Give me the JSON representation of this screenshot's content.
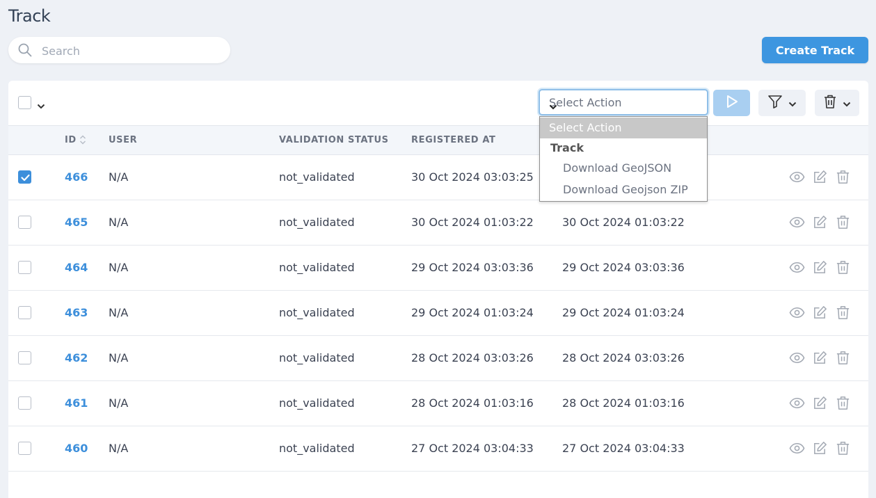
{
  "page": {
    "title": "Track"
  },
  "search": {
    "placeholder": "Search"
  },
  "create_button": {
    "label": "Create Track"
  },
  "toolbar": {
    "select_action": {
      "value": "Select Action"
    }
  },
  "dropdown": {
    "selected": "Select Action",
    "group_label": "Track",
    "options": [
      "Download GeoJSON",
      "Download Geojson ZIP"
    ]
  },
  "table": {
    "headers": {
      "id": "ID",
      "user": "USER",
      "validation_status": "VALIDATION STATUS",
      "registered_at": "REGISTERED AT"
    },
    "rows": [
      {
        "checked": true,
        "id": "466",
        "user": "N/A",
        "status": "not_validated",
        "registered": "30 Oct 2024 03:03:25",
        "updated": ""
      },
      {
        "checked": false,
        "id": "465",
        "user": "N/A",
        "status": "not_validated",
        "registered": "30 Oct 2024 01:03:22",
        "updated": "30 Oct 2024 01:03:22"
      },
      {
        "checked": false,
        "id": "464",
        "user": "N/A",
        "status": "not_validated",
        "registered": "29 Oct 2024 03:03:36",
        "updated": "29 Oct 2024 03:03:36"
      },
      {
        "checked": false,
        "id": "463",
        "user": "N/A",
        "status": "not_validated",
        "registered": "29 Oct 2024 01:03:24",
        "updated": "29 Oct 2024 01:03:24"
      },
      {
        "checked": false,
        "id": "462",
        "user": "N/A",
        "status": "not_validated",
        "registered": "28 Oct 2024 03:03:26",
        "updated": "28 Oct 2024 03:03:26"
      },
      {
        "checked": false,
        "id": "461",
        "user": "N/A",
        "status": "not_validated",
        "registered": "28 Oct 2024 01:03:16",
        "updated": "28 Oct 2024 01:03:16"
      },
      {
        "checked": false,
        "id": "460",
        "user": "N/A",
        "status": "not_validated",
        "registered": "27 Oct 2024 03:04:33",
        "updated": "27 Oct 2024 03:04:33"
      }
    ]
  },
  "colors": {
    "accent": "#3d96e0",
    "link": "#3d8fdb",
    "background": "#eef1f6"
  }
}
